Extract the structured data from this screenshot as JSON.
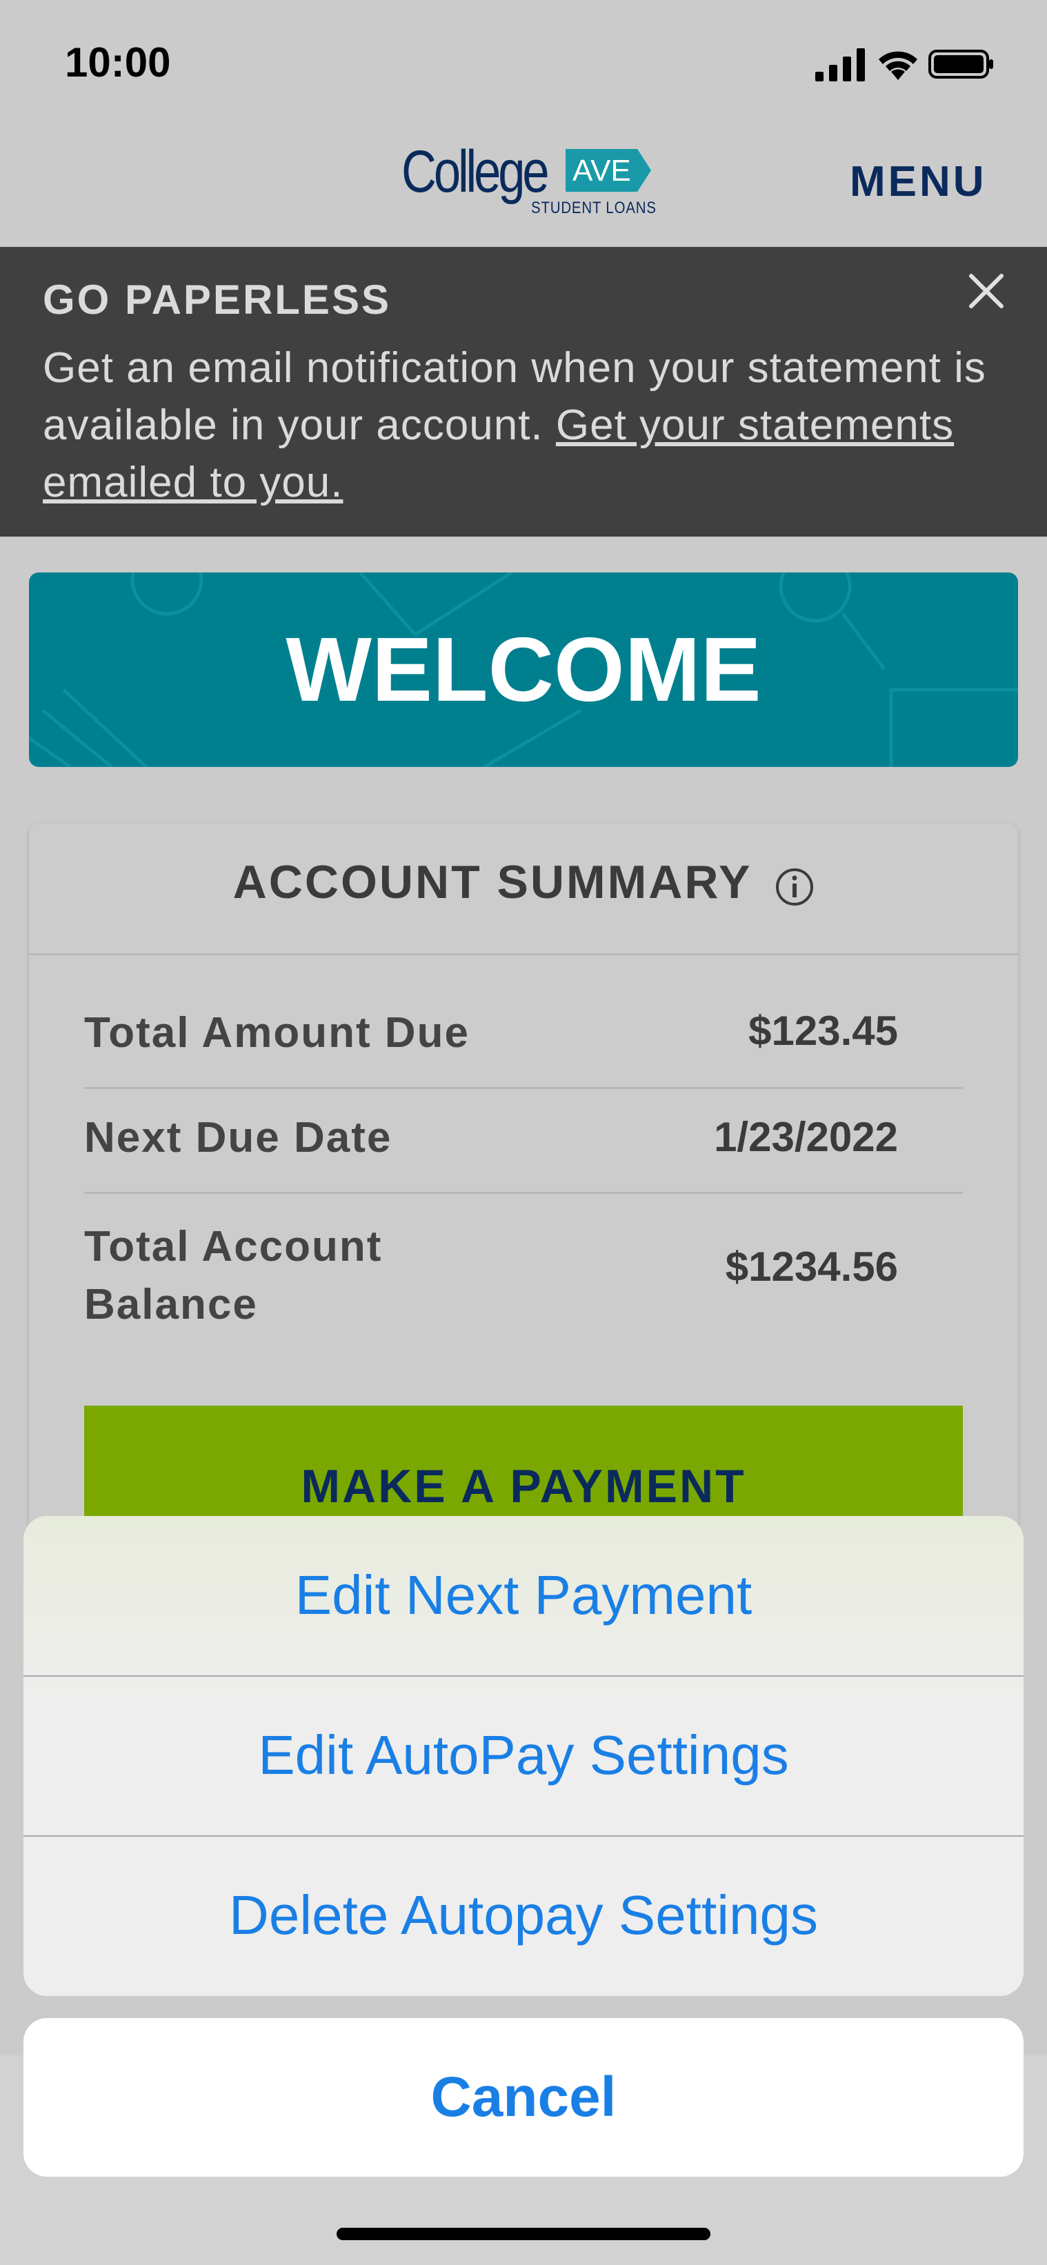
{
  "status_bar": {
    "time": "10:00"
  },
  "header": {
    "logo_main": "College",
    "logo_badge": "AVE",
    "logo_sub": "STUDENT LOANS",
    "menu_label": "MENU"
  },
  "banner": {
    "title": "GO PAPERLESS",
    "text": "Get an email notification when your statement is available in your account. ",
    "link": "Get your statements emailed to you."
  },
  "welcome": {
    "text": "WELCOME"
  },
  "summary": {
    "title": "ACCOUNT SUMMARY",
    "rows": [
      {
        "label": "Total Amount Due",
        "value": "$123.45"
      },
      {
        "label": "Next Due Date",
        "value": "1/23/2022"
      },
      {
        "label": "Total Account Balance",
        "value": "$1234.56"
      }
    ],
    "pay_button": "MAKE A PAYMENT"
  },
  "action_sheet": {
    "items": [
      {
        "label": "Edit Next Payment"
      },
      {
        "label": "Edit AutoPay Settings"
      },
      {
        "label": "Delete Autopay Settings"
      }
    ],
    "cancel": "Cancel"
  },
  "colors": {
    "brand_navy": "#0b2a5c",
    "teal": "#00808f",
    "green": "#7aa800",
    "ios_blue": "#1a7fe5"
  }
}
